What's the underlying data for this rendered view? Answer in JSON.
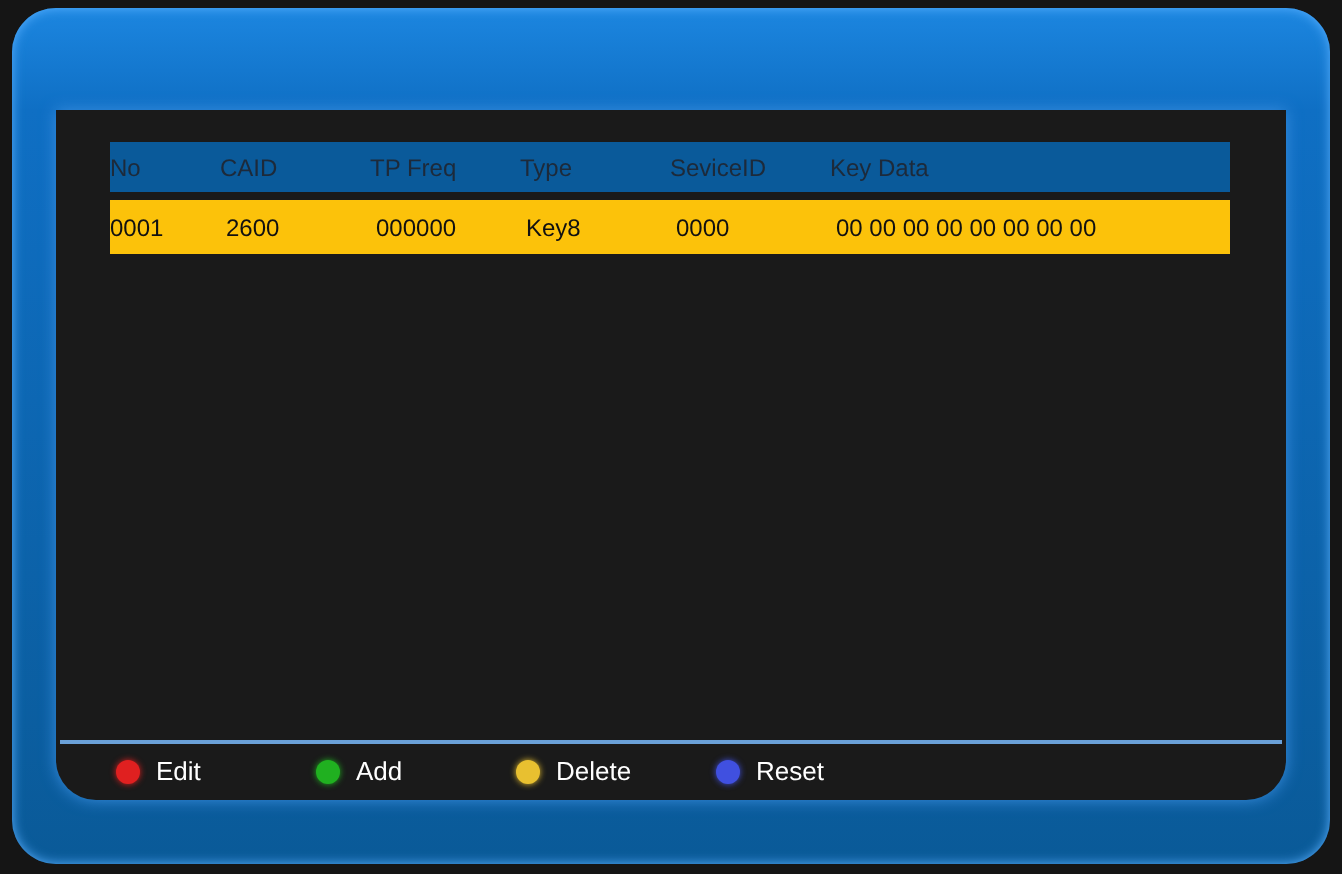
{
  "table": {
    "columns": [
      "No",
      "CAID",
      "TP Freq",
      "Type",
      "SeviceID",
      "Key Data"
    ],
    "rows": [
      {
        "cells": [
          "0001",
          "2600",
          "000000",
          "Key8",
          "0000",
          "00 00 00 00 00 00 00 00"
        ],
        "selected": true
      }
    ]
  },
  "keys": [
    {
      "label": "Edit",
      "color": "#e02020"
    },
    {
      "label": "Add",
      "color": "#20b020"
    },
    {
      "label": "Delete",
      "color": "#e8c030"
    },
    {
      "label": "Reset",
      "color": "#4050e0"
    }
  ]
}
